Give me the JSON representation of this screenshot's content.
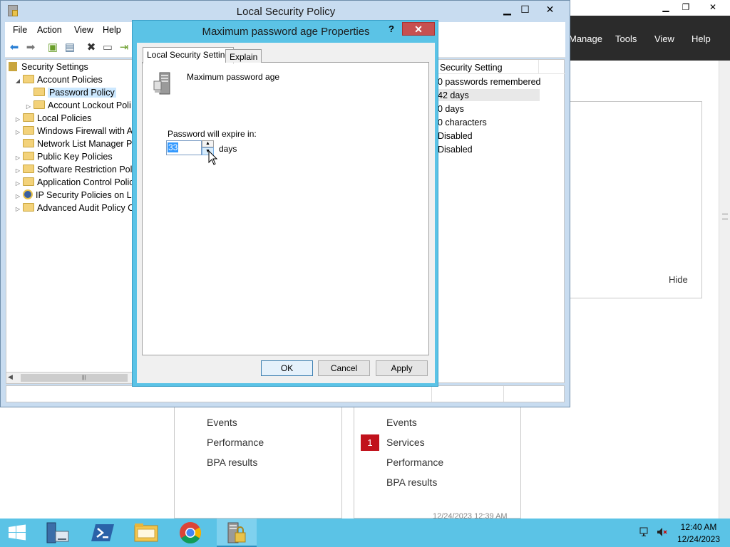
{
  "server_manager": {
    "menu": [
      "Manage",
      "Tools",
      "View",
      "Help"
    ],
    "hide_label": "Hide",
    "tiles": [
      {
        "items": [
          "Events",
          "Performance",
          "BPA results"
        ]
      },
      {
        "items": [
          "Events",
          "Services",
          "Performance",
          "BPA results"
        ],
        "badge": "1"
      }
    ],
    "timestamp": "12/24/2023 12:39 AM"
  },
  "lsp": {
    "title": "Local Security Policy",
    "menu": [
      "File",
      "Action",
      "View",
      "Help"
    ],
    "tree": [
      {
        "label": "Security Settings",
        "level": 0,
        "expander": "",
        "icon": "security-settings-icon"
      },
      {
        "label": "Account Policies",
        "level": 1,
        "expander": "◢",
        "icon": "folder-icon"
      },
      {
        "label": "Password Policy",
        "level": 2,
        "expander": "",
        "icon": "folder-icon",
        "selected": true
      },
      {
        "label": "Account Lockout Poli",
        "level": 2,
        "expander": "▷",
        "icon": "folder-icon"
      },
      {
        "label": "Local Policies",
        "level": 1,
        "expander": "▷",
        "icon": "folder-icon"
      },
      {
        "label": "Windows Firewall with Ac",
        "level": 1,
        "expander": "▷",
        "icon": "folder-icon"
      },
      {
        "label": "Network List Manager Po",
        "level": 1,
        "expander": "",
        "icon": "folder-icon"
      },
      {
        "label": "Public Key Policies",
        "level": 1,
        "expander": "▷",
        "icon": "folder-icon"
      },
      {
        "label": "Software Restriction Polic",
        "level": 1,
        "expander": "▷",
        "icon": "folder-icon"
      },
      {
        "label": "Application Control Polic",
        "level": 1,
        "expander": "▷",
        "icon": "folder-icon"
      },
      {
        "label": "IP Security Policies on Lo",
        "level": 1,
        "expander": "▷",
        "icon": "ip-security-icon"
      },
      {
        "label": "Advanced Audit Policy C",
        "level": 1,
        "expander": "▷",
        "icon": "folder-icon"
      }
    ],
    "list_header": "Security Setting",
    "list_values": [
      "0 passwords remembered",
      "42 days",
      "0 days",
      "0 characters",
      "Disabled",
      "Disabled"
    ]
  },
  "dialog": {
    "title": "Maximum password age Properties",
    "help": "?",
    "tabs": [
      "Local Security Setting",
      "Explain"
    ],
    "policy_name": "Maximum password age",
    "expire_label": "Password will expire in:",
    "value": "33",
    "unit": "days",
    "buttons": {
      "ok": "OK",
      "cancel": "Cancel",
      "apply": "Apply"
    }
  },
  "taskbar": {
    "icons": [
      "start-icon",
      "server-manager-icon",
      "powershell-icon",
      "file-explorer-icon",
      "chrome-icon",
      "local-security-policy-icon"
    ],
    "time": "12:40 AM",
    "date": "12/24/2023"
  },
  "colors": {
    "accent": "#5bc3e6",
    "close_button": "#c75050",
    "badge": "#c1121c",
    "selection": "#3399ff"
  }
}
